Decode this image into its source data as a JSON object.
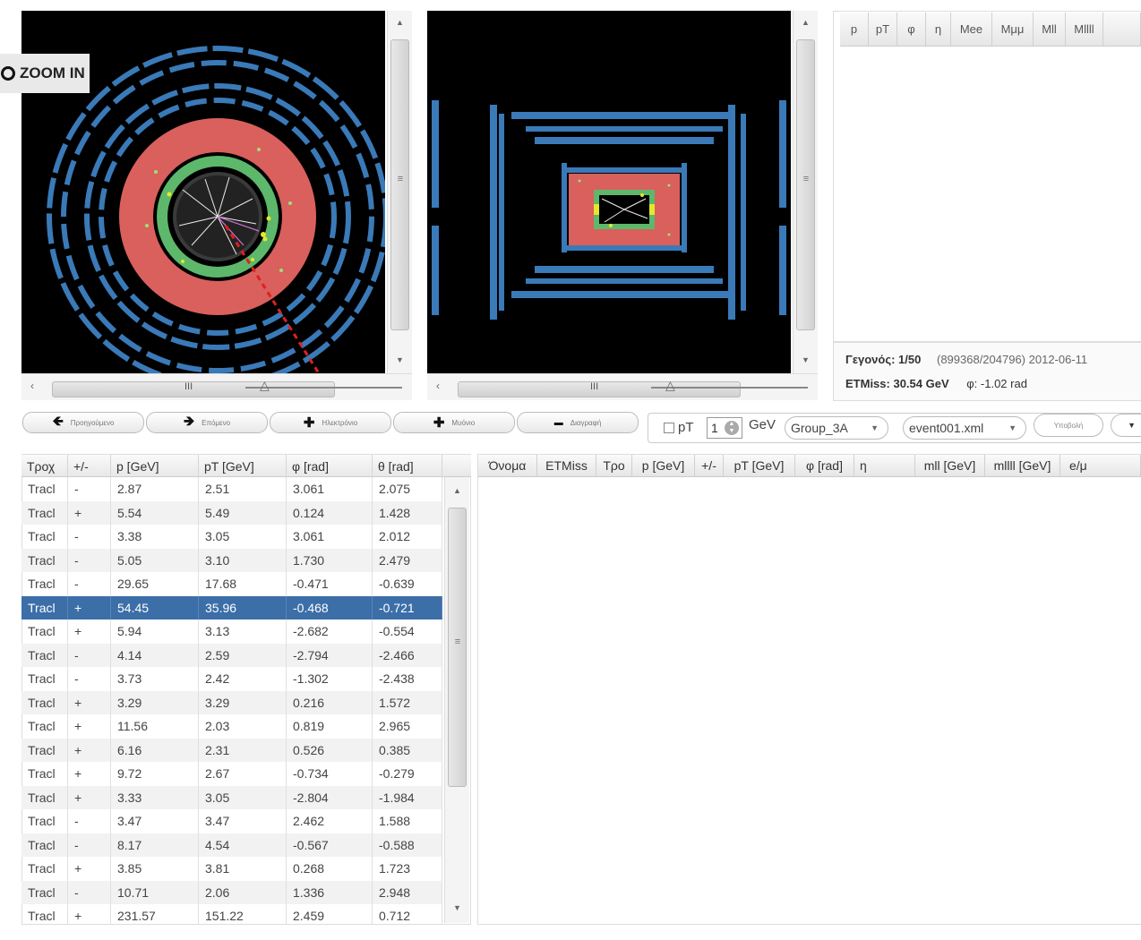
{
  "zoom": {
    "label": "ZOOM IN"
  },
  "summary_table": {
    "columns": [
      "p",
      "pT",
      "φ",
      "η",
      "Mee",
      "Mμμ",
      "Mll",
      "Mllll"
    ]
  },
  "event_info": {
    "event_label": "Γεγονός:",
    "event_value": "1/50",
    "event_ids": "(899368/204796) 2012-06-11",
    "etmiss_label": "ETMiss:",
    "etmiss_value": "30.54 GeV",
    "phi_text": "φ: -1.02 rad"
  },
  "nav_buttons": [
    {
      "icon": "arrow-left-icon",
      "glyph": "🡸",
      "label": "Προηγούμενο"
    },
    {
      "icon": "arrow-right-icon",
      "glyph": "🡺",
      "label": "Επόμενο"
    },
    {
      "icon": "plus-icon",
      "glyph": "✚",
      "label": "Ηλεκτρόνιο"
    },
    {
      "icon": "plus-icon",
      "glyph": "✚",
      "label": "Μυόνιο"
    },
    {
      "icon": "minus-icon",
      "glyph": "▬",
      "label": "Διαγραφή"
    }
  ],
  "controls": {
    "pt_label": "pT",
    "pt_value": "1",
    "unit": "GeV",
    "group_select": "Group_3A",
    "file_select": "event001.xml",
    "submit_label": "Υποβολή"
  },
  "tracks_table": {
    "columns": [
      "Τροχ",
      "+/-",
      "p [GeV]",
      "pT [GeV]",
      "φ [rad]",
      "θ [rad]"
    ],
    "selected_index": 5,
    "rows": [
      [
        "Tracl",
        "-",
        "2.87",
        "2.51",
        "3.061",
        "2.075"
      ],
      [
        "Tracl",
        "+",
        "5.54",
        "5.49",
        "0.124",
        "1.428"
      ],
      [
        "Tracl",
        "-",
        "3.38",
        "3.05",
        "3.061",
        "2.012"
      ],
      [
        "Tracl",
        "-",
        "5.05",
        "3.10",
        "1.730",
        "2.479"
      ],
      [
        "Tracl",
        "-",
        "29.65",
        "17.68",
        "-0.471",
        "-0.639"
      ],
      [
        "Tracl",
        "+",
        "54.45",
        "35.96",
        "-0.468",
        "-0.721"
      ],
      [
        "Tracl",
        "+",
        "5.94",
        "3.13",
        "-2.682",
        "-0.554"
      ],
      [
        "Tracl",
        "-",
        "4.14",
        "2.59",
        "-2.794",
        "-2.466"
      ],
      [
        "Tracl",
        "-",
        "3.73",
        "2.42",
        "-1.302",
        "-2.438"
      ],
      [
        "Tracl",
        "+",
        "3.29",
        "3.29",
        "0.216",
        "1.572"
      ],
      [
        "Tracl",
        "+",
        "11.56",
        "2.03",
        "0.819",
        "2.965"
      ],
      [
        "Tracl",
        "+",
        "6.16",
        "2.31",
        "0.526",
        "0.385"
      ],
      [
        "Tracl",
        "+",
        "9.72",
        "2.67",
        "-0.734",
        "-0.279"
      ],
      [
        "Tracl",
        "+",
        "3.33",
        "3.05",
        "-2.804",
        "-1.984"
      ],
      [
        "Tracl",
        "-",
        "3.47",
        "3.47",
        "2.462",
        "1.588"
      ],
      [
        "Tracl",
        "-",
        "8.17",
        "4.54",
        "-0.567",
        "-0.588"
      ],
      [
        "Tracl",
        "+",
        "3.85",
        "3.81",
        "0.268",
        "1.723"
      ],
      [
        "Tracl",
        "-",
        "10.71",
        "2.06",
        "1.336",
        "2.948"
      ],
      [
        "Tracl",
        "+",
        "231.57",
        "151.22",
        "2.459",
        "0.712"
      ]
    ]
  },
  "selection_table": {
    "columns": [
      "Όνομα",
      "ETMiss",
      "Τρο",
      "p [GeV]",
      "+/-",
      "pT [GeV]",
      "φ [rad]",
      "η",
      "mll [GeV]",
      "mllll [GeV]",
      "e/μ"
    ]
  },
  "colors": {
    "calorimeter_red": "#d9605c",
    "inner_green": "#5db86b",
    "muon_blue": "#3a7ab8",
    "selected_row": "#3c6ea8"
  }
}
